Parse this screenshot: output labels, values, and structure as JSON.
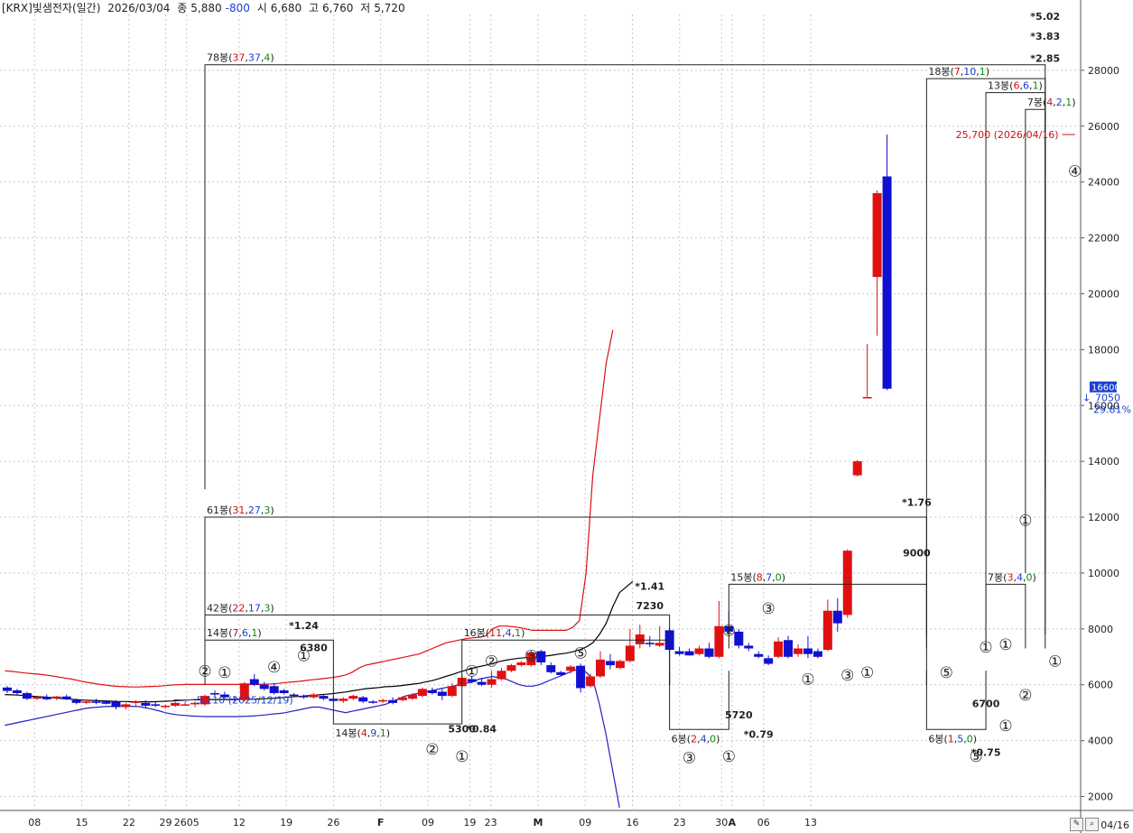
{
  "header": {
    "title": "[KRX]빛샘전자(일간)",
    "date": "2026/03/04",
    "close_label": "종",
    "close": "5,880",
    "change": "-800",
    "open_label": "시",
    "open": "6,680",
    "high_label": "고",
    "high": "6,760",
    "low_label": "저",
    "low": "5,720"
  },
  "footer": {
    "date_end": "04/16",
    "icons": [
      "edit-icon",
      "zoom-icon"
    ]
  },
  "chart_data": {
    "type": "candlestick",
    "ylim": [
      1500,
      30000
    ],
    "y_ticks": [
      2000,
      4000,
      6000,
      8000,
      10000,
      12000,
      14000,
      16000,
      18000,
      20000,
      22000,
      24000,
      26000,
      28000
    ],
    "x_ticks": [
      "08",
      "15",
      "22",
      "29",
      "2605",
      "12",
      "19",
      "26",
      "F",
      "09",
      "19",
      "23",
      "M",
      "09",
      "16",
      "23",
      "30",
      "A",
      "06",
      "13"
    ],
    "grid": true,
    "colors": {
      "up": "#e01010",
      "down": "#1010d0",
      "upper_band": "#e01010",
      "lower_band": "#2020c0",
      "ma": "#000000",
      "box": "#000000",
      "wave": "#222222"
    },
    "candles": [
      {
        "o": 5900,
        "h": 5950,
        "l": 5700,
        "c": 5780
      },
      {
        "o": 5800,
        "h": 5850,
        "l": 5650,
        "c": 5700
      },
      {
        "o": 5700,
        "h": 5750,
        "l": 5450,
        "c": 5500
      },
      {
        "o": 5500,
        "h": 5600,
        "l": 5450,
        "c": 5560
      },
      {
        "o": 5560,
        "h": 5650,
        "l": 5450,
        "c": 5480
      },
      {
        "o": 5520,
        "h": 5600,
        "l": 5450,
        "c": 5580
      },
      {
        "o": 5580,
        "h": 5650,
        "l": 5450,
        "c": 5480
      },
      {
        "o": 5450,
        "h": 5500,
        "l": 5300,
        "c": 5350
      },
      {
        "o": 5350,
        "h": 5450,
        "l": 5300,
        "c": 5400
      },
      {
        "o": 5400,
        "h": 5500,
        "l": 5300,
        "c": 5350
      },
      {
        "o": 5400,
        "h": 5450,
        "l": 5300,
        "c": 5320
      },
      {
        "o": 5400,
        "h": 5450,
        "l": 5120,
        "c": 5200
      },
      {
        "o": 5200,
        "h": 5350,
        "l": 5110,
        "c": 5300
      },
      {
        "o": 5350,
        "h": 5450,
        "l": 5250,
        "c": 5400
      },
      {
        "o": 5350,
        "h": 5450,
        "l": 5150,
        "c": 5250
      },
      {
        "o": 5300,
        "h": 5400,
        "l": 5200,
        "c": 5250
      },
      {
        "o": 5200,
        "h": 5300,
        "l": 5150,
        "c": 5250
      },
      {
        "o": 5250,
        "h": 5400,
        "l": 5200,
        "c": 5350
      },
      {
        "o": 5300,
        "h": 5400,
        "l": 5250,
        "c": 5300
      },
      {
        "o": 5300,
        "h": 5400,
        "l": 5200,
        "c": 5350
      },
      {
        "o": 5300,
        "h": 5650,
        "l": 5250,
        "c": 5600
      },
      {
        "o": 5700,
        "h": 5800,
        "l": 5600,
        "c": 5650
      },
      {
        "o": 5650,
        "h": 5750,
        "l": 5500,
        "c": 5550
      },
      {
        "o": 5500,
        "h": 5600,
        "l": 5400,
        "c": 5450
      },
      {
        "o": 5450,
        "h": 6100,
        "l": 5400,
        "c": 6050
      },
      {
        "o": 6200,
        "h": 6380,
        "l": 5950,
        "c": 6000
      },
      {
        "o": 6000,
        "h": 6100,
        "l": 5800,
        "c": 5850
      },
      {
        "o": 5950,
        "h": 6050,
        "l": 5650,
        "c": 5700
      },
      {
        "o": 5800,
        "h": 5850,
        "l": 5650,
        "c": 5700
      },
      {
        "o": 5650,
        "h": 5700,
        "l": 5550,
        "c": 5600
      },
      {
        "o": 5600,
        "h": 5650,
        "l": 5500,
        "c": 5550
      },
      {
        "o": 5550,
        "h": 5700,
        "l": 5500,
        "c": 5650
      },
      {
        "o": 5600,
        "h": 5650,
        "l": 5450,
        "c": 5500
      },
      {
        "o": 5500,
        "h": 5550,
        "l": 5400,
        "c": 5420
      },
      {
        "o": 5420,
        "h": 5550,
        "l": 5350,
        "c": 5500
      },
      {
        "o": 5500,
        "h": 5650,
        "l": 5450,
        "c": 5600
      },
      {
        "o": 5550,
        "h": 5600,
        "l": 5350,
        "c": 5400
      },
      {
        "o": 5400,
        "h": 5450,
        "l": 5320,
        "c": 5380
      },
      {
        "o": 5400,
        "h": 5500,
        "l": 5350,
        "c": 5450
      },
      {
        "o": 5450,
        "h": 5550,
        "l": 5300,
        "c": 5350
      },
      {
        "o": 5450,
        "h": 5600,
        "l": 5400,
        "c": 5550
      },
      {
        "o": 5500,
        "h": 5700,
        "l": 5450,
        "c": 5650
      },
      {
        "o": 5600,
        "h": 5900,
        "l": 5550,
        "c": 5850
      },
      {
        "o": 5800,
        "h": 5900,
        "l": 5650,
        "c": 5700
      },
      {
        "o": 5750,
        "h": 5850,
        "l": 5450,
        "c": 5600
      },
      {
        "o": 5600,
        "h": 6050,
        "l": 5550,
        "c": 5950
      },
      {
        "o": 5950,
        "h": 6350,
        "l": 5900,
        "c": 6250
      },
      {
        "o": 6200,
        "h": 6300,
        "l": 6050,
        "c": 6100
      },
      {
        "o": 6100,
        "h": 6250,
        "l": 5950,
        "c": 6000
      },
      {
        "o": 6000,
        "h": 6500,
        "l": 5900,
        "c": 6200
      },
      {
        "o": 6200,
        "h": 6600,
        "l": 6150,
        "c": 6500
      },
      {
        "o": 6500,
        "h": 6750,
        "l": 6450,
        "c": 6700
      },
      {
        "o": 6700,
        "h": 6850,
        "l": 6650,
        "c": 6800
      },
      {
        "o": 6700,
        "h": 7230,
        "l": 6650,
        "c": 7150
      },
      {
        "o": 7200,
        "h": 7250,
        "l": 6700,
        "c": 6800
      },
      {
        "o": 6700,
        "h": 6800,
        "l": 6400,
        "c": 6450
      },
      {
        "o": 6450,
        "h": 6500,
        "l": 6300,
        "c": 6350
      },
      {
        "o": 6500,
        "h": 6700,
        "l": 6400,
        "c": 6650
      },
      {
        "o": 6680,
        "h": 6760,
        "l": 5720,
        "c": 5880
      },
      {
        "o": 5950,
        "h": 6400,
        "l": 5900,
        "c": 6300
      },
      {
        "o": 6300,
        "h": 7200,
        "l": 6250,
        "c": 6900
      },
      {
        "o": 6850,
        "h": 7100,
        "l": 6550,
        "c": 6700
      },
      {
        "o": 6600,
        "h": 6900,
        "l": 6550,
        "c": 6850
      },
      {
        "o": 6850,
        "h": 8000,
        "l": 6800,
        "c": 7400
      },
      {
        "o": 7450,
        "h": 8150,
        "l": 7300,
        "c": 7800
      },
      {
        "o": 7500,
        "h": 7750,
        "l": 7350,
        "c": 7450
      },
      {
        "o": 7400,
        "h": 8100,
        "l": 7350,
        "c": 7500
      },
      {
        "o": 7950,
        "h": 8050,
        "l": 7200,
        "c": 7250
      },
      {
        "o": 7200,
        "h": 7350,
        "l": 7050,
        "c": 7100
      },
      {
        "o": 7200,
        "h": 7300,
        "l": 7050,
        "c": 7050
      },
      {
        "o": 7100,
        "h": 7400,
        "l": 7050,
        "c": 7300
      },
      {
        "o": 7300,
        "h": 7500,
        "l": 6950,
        "c": 7000
      },
      {
        "o": 7000,
        "h": 9000,
        "l": 6950,
        "c": 8100
      },
      {
        "o": 8100,
        "h": 8650,
        "l": 7800,
        "c": 7900
      },
      {
        "o": 7900,
        "h": 8000,
        "l": 7300,
        "c": 7400
      },
      {
        "o": 7400,
        "h": 7500,
        "l": 7200,
        "c": 7300
      },
      {
        "o": 7100,
        "h": 7200,
        "l": 6950,
        "c": 7000
      },
      {
        "o": 6950,
        "h": 7050,
        "l": 6700,
        "c": 6750
      },
      {
        "o": 7000,
        "h": 7700,
        "l": 6950,
        "c": 7550
      },
      {
        "o": 7600,
        "h": 7750,
        "l": 6950,
        "c": 7000
      },
      {
        "o": 7100,
        "h": 7450,
        "l": 7000,
        "c": 7300
      },
      {
        "o": 7300,
        "h": 7750,
        "l": 6950,
        "c": 7100
      },
      {
        "o": 7200,
        "h": 7300,
        "l": 6950,
        "c": 7000
      },
      {
        "o": 7250,
        "h": 9050,
        "l": 7200,
        "c": 8650
      },
      {
        "o": 8650,
        "h": 9100,
        "l": 7900,
        "c": 8200
      },
      {
        "o": 8500,
        "h": 10850,
        "l": 8400,
        "c": 10800
      },
      {
        "o": 13500,
        "h": 14050,
        "l": 13450,
        "c": 14000
      },
      {
        "o": 16300,
        "h": 18200,
        "l": 16300,
        "c": 16300
      },
      {
        "o": 20600,
        "h": 23700,
        "l": 18500,
        "c": 23600
      },
      {
        "o": 24200,
        "h": 25700,
        "l": 16550,
        "c": 16600
      }
    ],
    "upper_band": [
      6500,
      6480,
      6450,
      6420,
      6400,
      6380,
      6350,
      6320,
      6280,
      6240,
      6200,
      6150,
      6100,
      6060,
      6020,
      5990,
      5960,
      5940,
      5930,
      5920,
      5920,
      5930,
      5940,
      5950,
      5970,
      5990,
      6000,
      6010,
      6010,
      6010,
      6010,
      6010,
      6010,
      6010,
      6010,
      6010,
      6010,
      6010,
      6010,
      6020,
      6030,
      6050,
      6080,
      6100,
      6120,
      6150,
      6180,
      6200,
      6230,
      6260,
      6300,
      6350,
      6450,
      6600,
      6700,
      6750,
      6800,
      6850,
      6900,
      6950,
      7000,
      7050,
      7100,
      7200,
      7300,
      7400,
      7500,
      7550,
      7600,
      7650,
      7680,
      7700,
      7750,
      8000,
      8100,
      8100,
      8080,
      8050,
      8000,
      7950,
      7950,
      7950,
      7950,
      7950,
      7950,
      8050,
      8300,
      10000,
      13500,
      15500,
      17500,
      18700
    ],
    "ma": [
      5650,
      5640,
      5630,
      5610,
      5590,
      5570,
      5560,
      5540,
      5520,
      5500,
      5480,
      5460,
      5450,
      5440,
      5430,
      5420,
      5410,
      5400,
      5400,
      5390,
      5390,
      5390,
      5390,
      5400,
      5410,
      5420,
      5440,
      5450,
      5460,
      5460,
      5470,
      5470,
      5470,
      5470,
      5470,
      5480,
      5480,
      5480,
      5490,
      5500,
      5510,
      5530,
      5550,
      5570,
      5580,
      5600,
      5620,
      5640,
      5660,
      5680,
      5710,
      5740,
      5780,
      5820,
      5860,
      5880,
      5900,
      5930,
      5940,
      5960,
      5990,
      6020,
      6050,
      6100,
      6150,
      6220,
      6300,
      6370,
      6450,
      6520,
      6590,
      6650,
      6700,
      6760,
      6830,
      6880,
      6920,
      6950,
      6970,
      6980,
      7000,
      7030,
      7060,
      7100,
      7130,
      7180,
      7250,
      7350,
      7500,
      7800,
      8200,
      8800,
      9300,
      9500,
      9700
    ],
    "lower_band": [
      4550,
      4600,
      4650,
      4700,
      4750,
      4800,
      4850,
      4900,
      4950,
      5000,
      5050,
      5100,
      5150,
      5180,
      5200,
      5220,
      5230,
      5240,
      5240,
      5230,
      5220,
      5180,
      5130,
      5070,
      5000,
      4950,
      4920,
      4900,
      4880,
      4870,
      4860,
      4860,
      4860,
      4860,
      4860,
      4860,
      4870,
      4880,
      4900,
      4920,
      4950,
      4970,
      5000,
      5050,
      5100,
      5150,
      5200,
      5200,
      5150,
      5100,
      5050,
      5000,
      5050,
      5100,
      5150,
      5200,
      5250,
      5300,
      5400,
      5500,
      5600,
      5650,
      5700,
      5750,
      5800,
      5850,
      5900,
      5950,
      6000,
      6050,
      6100,
      6200,
      6250,
      6300,
      6250,
      6200,
      6100,
      6000,
      5950,
      5950,
      6000,
      6100,
      6200,
      6300,
      6400,
      6500,
      6550,
      6450,
      6200,
      5300,
      4200,
      2900,
      1600
    ],
    "boxes": [
      {
        "from": 20,
        "to": 105,
        "level": 28200,
        "bottom": 13000,
        "count": "78",
        "up": "37",
        "down": "37",
        "flat": "4"
      },
      {
        "from": 20,
        "to": 93,
        "level": 12000,
        "bottom": 6000,
        "count": "61",
        "up": "31",
        "down": "27",
        "flat": "3"
      },
      {
        "from": 20,
        "to": 67,
        "level": 8500,
        "bottom": 6000,
        "count": "42",
        "up": "22",
        "down": "17",
        "flat": "3"
      },
      {
        "from": 20,
        "to": 33,
        "level": 7600,
        "bottom": 6000,
        "count": "14",
        "up": "7",
        "down": "6",
        "flat": "1"
      },
      {
        "from": 33,
        "to": 46,
        "level": 4600,
        "top": 6000,
        "count": "14",
        "up": "4",
        "down": "9",
        "flat": "1",
        "below": true
      },
      {
        "from": 46,
        "to": 67,
        "level": 7600,
        "bottom": 6000,
        "count": "16",
        "up": "11",
        "down": "4",
        "flat": "1"
      },
      {
        "from": 67,
        "to": 73,
        "level": 4400,
        "top": 6500,
        "count": "6",
        "up": "2",
        "down": "4",
        "flat": "0",
        "below": true
      },
      {
        "from": 73,
        "to": 93,
        "level": 9600,
        "bottom": 7300,
        "count": "15",
        "up": "8",
        "down": "7",
        "flat": "0"
      },
      {
        "from": 93,
        "to": 105,
        "level": 27700,
        "bottom": 7800,
        "count": "18",
        "up": "7",
        "down": "10",
        "flat": "1"
      },
      {
        "from": 93,
        "to": 99,
        "level": 4400,
        "top": 6500,
        "count": "6",
        "up": "1",
        "down": "5",
        "flat": "0",
        "below": true
      },
      {
        "from": 99,
        "to": 105,
        "level": 27200,
        "bottom": 7300,
        "count": "13",
        "up": "6",
        "down": "6",
        "flat": "1"
      },
      {
        "from": 99,
        "to": 103,
        "level": 9600,
        "bottom": 7300,
        "count": "7",
        "up": "3",
        "down": "4",
        "flat": "0"
      },
      {
        "from": 103,
        "to": 105,
        "level": 26600,
        "bottom": 10000,
        "count": "7",
        "up": "4",
        "down": "2",
        "flat": "1"
      }
    ],
    "ratios": [
      {
        "i": 105,
        "v": 29800,
        "t": "*5.02"
      },
      {
        "i": 105,
        "v": 29100,
        "t": "*3.83"
      },
      {
        "i": 105,
        "v": 28300,
        "t": "*2.85"
      },
      {
        "i": 92,
        "v": 12400,
        "t": "*1.76"
      },
      {
        "i": 65,
        "v": 9400,
        "t": "*1.41"
      },
      {
        "i": 30,
        "v": 8000,
        "t": "*1.24"
      },
      {
        "i": 48,
        "v": 4300,
        "t": "*0.84"
      },
      {
        "i": 76,
        "v": 4100,
        "t": "*0.79"
      },
      {
        "i": 99,
        "v": 3450,
        "t": "*0.75"
      }
    ],
    "price_labels": [
      {
        "i": 92,
        "v": 10600,
        "t": "9000"
      },
      {
        "i": 65,
        "v": 8700,
        "t": "7230"
      },
      {
        "i": 31,
        "v": 7200,
        "t": "6380"
      },
      {
        "i": 46,
        "v": 4300,
        "t": "5300"
      },
      {
        "i": 74,
        "v": 4800,
        "t": "5720"
      },
      {
        "i": 99,
        "v": 5200,
        "t": "6700"
      }
    ],
    "waves": [
      {
        "i": 20,
        "v": 6300,
        "t": "②"
      },
      {
        "i": 22,
        "v": 6250,
        "t": "①"
      },
      {
        "i": 27,
        "v": 6450,
        "t": "④"
      },
      {
        "i": 30,
        "v": 6850,
        "t": "①"
      },
      {
        "i": 43,
        "v": 3500,
        "t": "②"
      },
      {
        "i": 46,
        "v": 3250,
        "t": "①"
      },
      {
        "i": 47,
        "v": 6300,
        "t": "①"
      },
      {
        "i": 49,
        "v": 6650,
        "t": "②"
      },
      {
        "i": 53,
        "v": 6850,
        "t": "③"
      },
      {
        "i": 58,
        "v": 6950,
        "t": "⑤"
      },
      {
        "i": 69,
        "v": 3200,
        "t": "③"
      },
      {
        "i": 73,
        "v": 3250,
        "t": "①"
      },
      {
        "i": 73,
        "v": 7750,
        "t": "②"
      },
      {
        "i": 77,
        "v": 8550,
        "t": "③"
      },
      {
        "i": 81,
        "v": 6000,
        "t": "①"
      },
      {
        "i": 85,
        "v": 6150,
        "t": "③"
      },
      {
        "i": 87,
        "v": 6250,
        "t": "①"
      },
      {
        "i": 95,
        "v": 6250,
        "t": "⑤"
      },
      {
        "i": 98,
        "v": 3250,
        "t": "⑤"
      },
      {
        "i": 101,
        "v": 4350,
        "t": "①"
      },
      {
        "i": 99,
        "v": 7150,
        "t": "①"
      },
      {
        "i": 101,
        "v": 7250,
        "t": "①"
      },
      {
        "i": 103,
        "v": 11700,
        "t": "①"
      },
      {
        "i": 103,
        "v": 5450,
        "t": "②"
      },
      {
        "i": 106,
        "v": 6650,
        "t": "①"
      },
      {
        "i": 108,
        "v": 24200,
        "t": "④"
      }
    ],
    "markers": [
      {
        "i": 26,
        "v": 5200,
        "t": "5,110 (2025/12/19)",
        "color": "#1a3fd0",
        "dir": "left"
      },
      {
        "i": 108,
        "v": 25700,
        "t": "25,700 (2026/04/16)",
        "color": "#d01010",
        "dir": "right"
      }
    ],
    "last": {
      "price": "16600",
      "change": "7050",
      "pct": "29.81%",
      "change_arrow": "↓"
    }
  }
}
